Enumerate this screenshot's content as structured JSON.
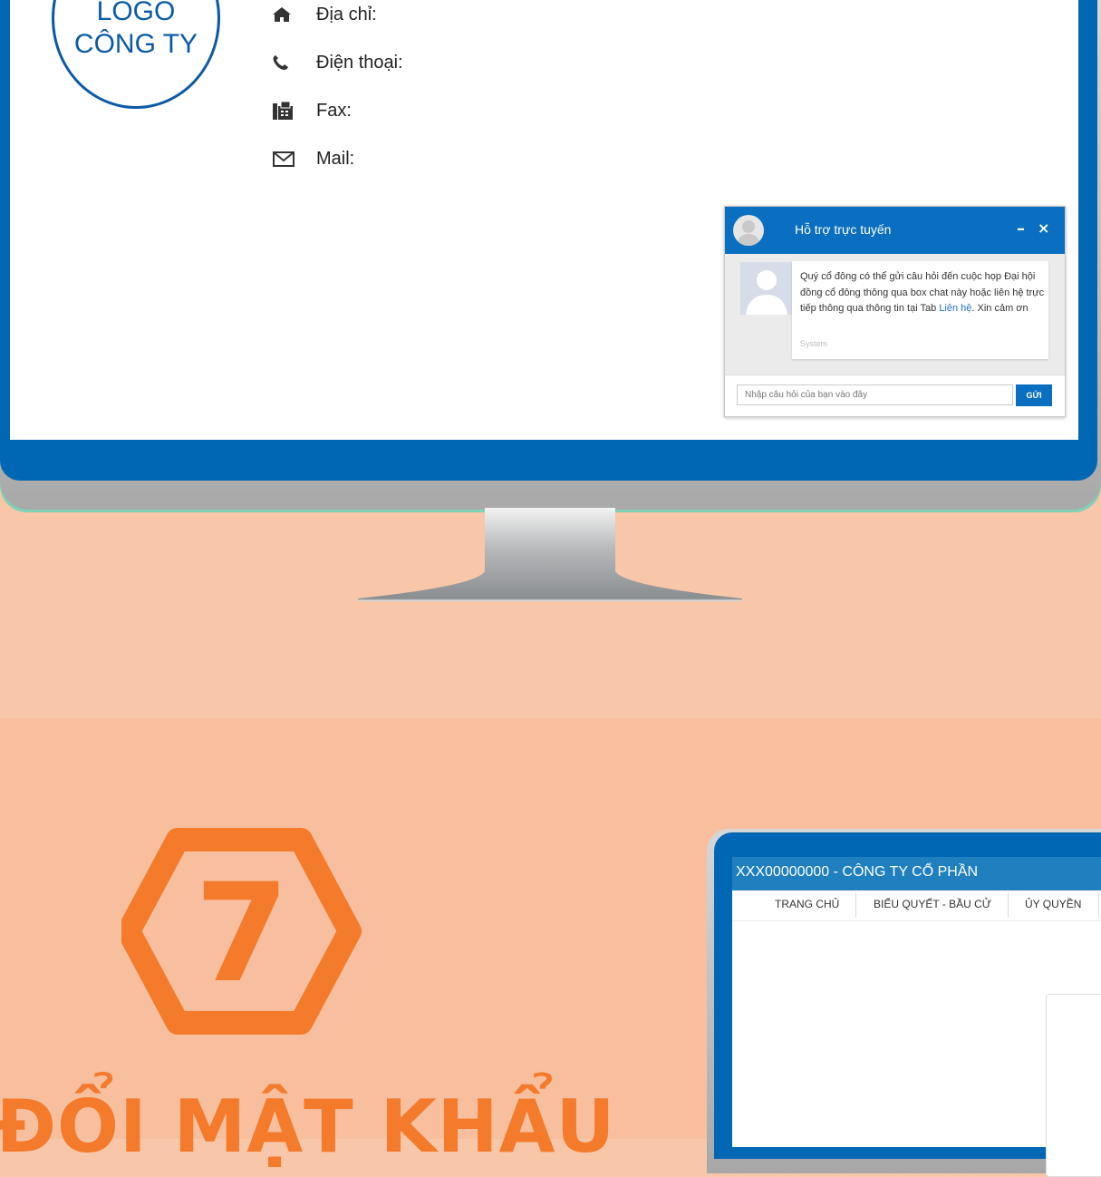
{
  "logo": {
    "line1": "LOGO",
    "line2": "CÔNG TY"
  },
  "contact": {
    "address_label": "Địa chỉ:",
    "phone_label": "Điện thoại:",
    "fax_label": "Fax:",
    "mail_label": "Mail:"
  },
  "chat": {
    "title": "Hỗ trợ trực tuyến",
    "minimize": "–",
    "close": "×",
    "message_text": "Quý cổ đông có thể gửi câu hỏi đến cuộc họp Đại hội đồng cổ đông thông qua box chat này hoặc liên hệ trực tiếp thông qua thông tin tại Tab ",
    "message_link": "Liên hệ",
    "message_end": ". Xin cảm ơn",
    "sender": "System",
    "input_placeholder": "Nhập câu hỏi của bạn vào đây",
    "send_label": "GỬI"
  },
  "step": {
    "number": "7",
    "heading": "ĐỔI MẬT KHẨU"
  },
  "second_screen": {
    "title": "XXX00000000 - CÔNG TY CỔ PHẦN",
    "menu": [
      "TRANG CHỦ",
      "BIỂU QUYẾT - BẦU CỬ",
      "ỦY QUYỀN"
    ]
  },
  "colors": {
    "brand_blue": "#0067b5",
    "accent_orange": "#f47a2c",
    "background_peach": "#f8c6a8"
  }
}
